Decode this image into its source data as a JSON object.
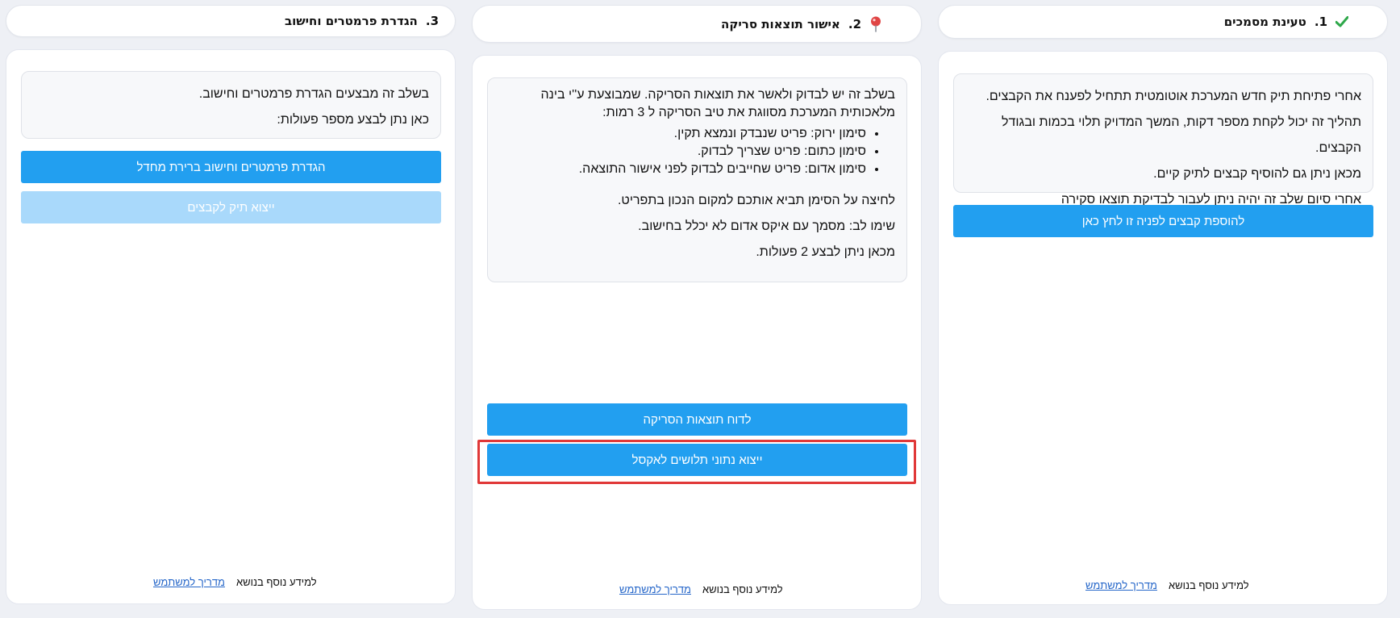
{
  "steps": [
    {
      "number": "1.",
      "title": "טעינת מסמכים",
      "icon": "check-icon",
      "info": [
        "אחרי פתיחת תיק חדש המערכת אוטומטית תתחיל לפענח את הקבצים.",
        "תהליך זה יכול לקחת מספר דקות, המשך המדויק תלוי בכמות ובגודל הקבצים.",
        "מכאן ניתן גם להוסיף קבצים לתיק קיים.",
        "אחרי סיום שלב זה יהיה ניתן לעבור לבדיקת תוצאו סקירה"
      ],
      "buttons": [
        "להוספת קבצים לפניה זו לחץ כאן"
      ],
      "footer_text": "למידע נוסף בנושא",
      "footer_link": "מדריך למשתמש"
    },
    {
      "number": "2.",
      "title": "אישור תוצאות סריקה",
      "icon": "map-pin-icon",
      "intro": "בשלב זה יש לבדוק ולאשר את תוצאות הסריקה. שמבוצעת ע''י בינה מלאכותית המערכת מסווגת את טיב הסריקה ל 3 רמות:",
      "bullets": [
        "סימון ירוק: פריט שנבדק ונמצא תקין.",
        "סימון כתום: פריט שצריך לבדוק.",
        "סימון אדום: פריט שחייבים לבדוק לפני אישור התוצאה."
      ],
      "notes": [
        "לחיצה על הסימן תביא אותכם למקום הנכון בתפריט.",
        "שימו לב: מסמך עם איקס אדום לא יכלל בחישוב.",
        "מכאן ניתן לבצע 2 פעולות."
      ],
      "buttons": [
        "לדוח תוצאות הסריקה",
        "ייצוא נתוני תלושים לאקסל"
      ],
      "footer_text": "למידע נוסף בנושא",
      "footer_link": "מדריך למשתמש"
    },
    {
      "number": "3.",
      "title": "הגדרת פרמטרים וחישוב",
      "info": [
        "בשלב זה מבצעים הגדרת פרמטרים וחישוב.",
        "כאן נתן לבצע מספר פעולות:"
      ],
      "buttons": [
        "הגדרת פרמטרים וחישוב ברירת מחדל",
        "ייצוא תיק לקבצים"
      ],
      "footer_text": "למידע נוסף בנושא",
      "footer_link": "מדריך למשתמש"
    }
  ],
  "colors": {
    "accent": "#229ff0",
    "accent_disabled": "#a9d9fb",
    "check": "#2ea84a",
    "pin": "#e04545",
    "highlight": "#e03838",
    "link": "#2566c9"
  }
}
